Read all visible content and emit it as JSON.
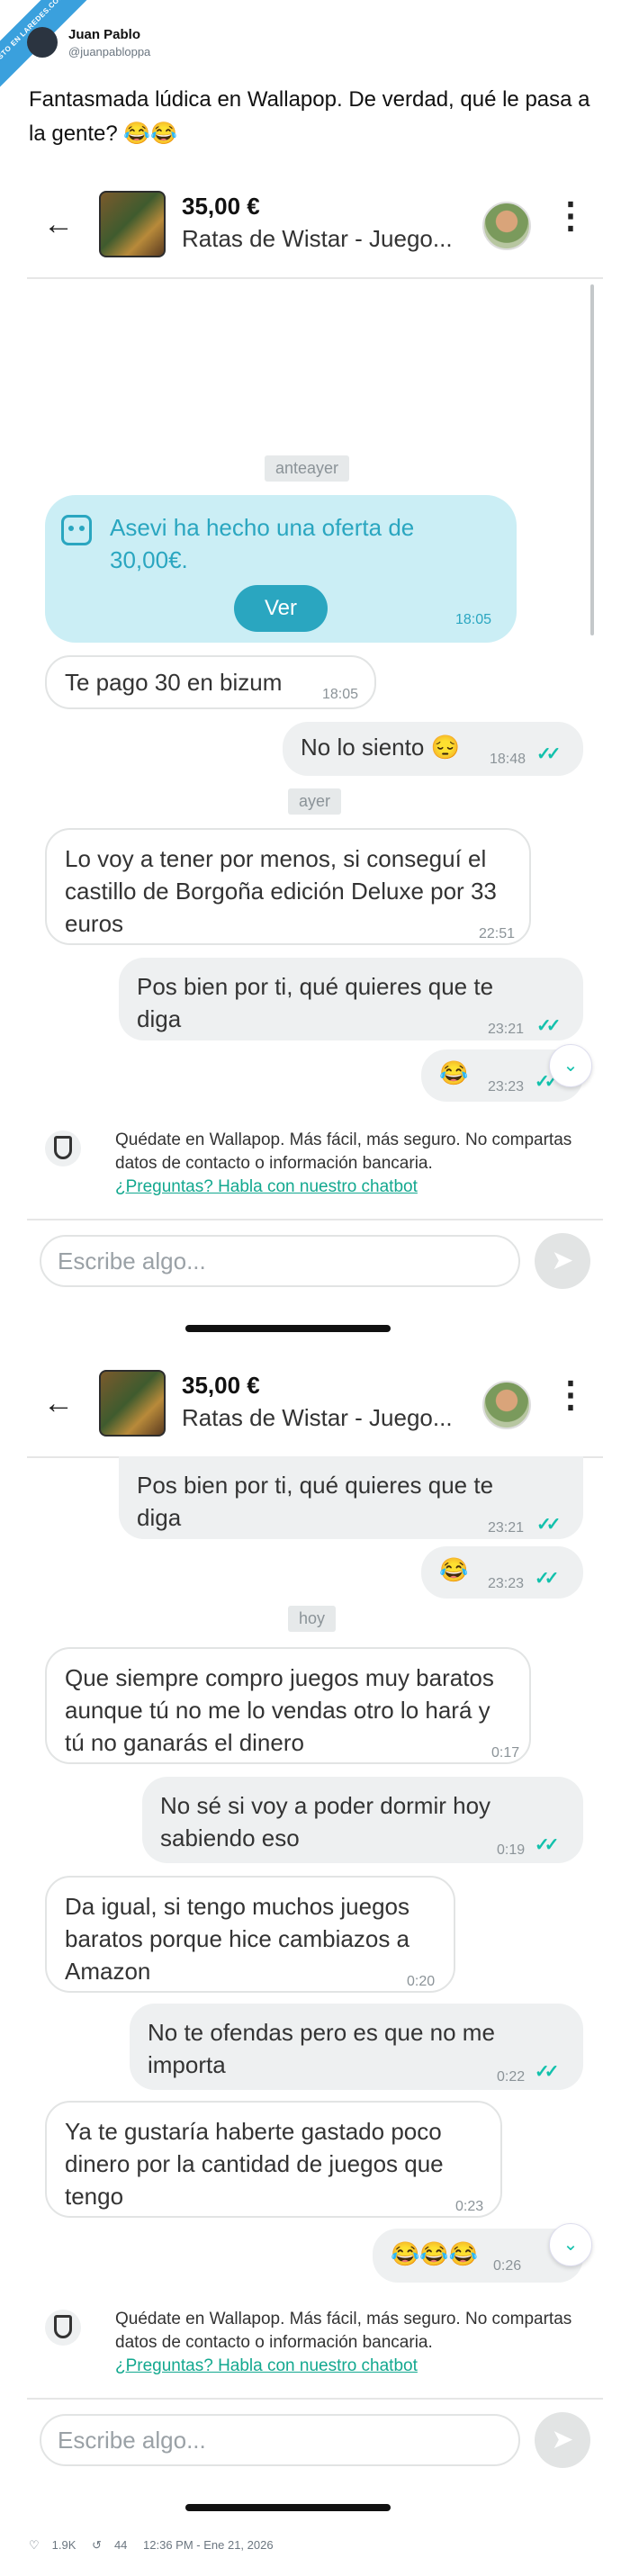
{
  "tweet": {
    "ribbon_text": "VISTO EN LAREDES.COM",
    "author_name": "Juan Pablo",
    "author_handle": "@juanpabloppa",
    "text": "Fantasmada lúdica en Wallapop. De verdad, qué le pasa a la gente? 😂😂"
  },
  "listing": {
    "price": "35,00 €",
    "title": "Ratas de Wistar - Juego..."
  },
  "screen1": {
    "day1": "anteayer",
    "offer_text": "Asevi ha hecho una oferta de 30,00€.",
    "offer_button": "Ver",
    "offer_time": "18:05",
    "m1": {
      "text": "Te pago 30 en bizum",
      "time": "18:05"
    },
    "m2": {
      "text": "No lo siento 😔",
      "time": "18:48"
    },
    "day2": "ayer",
    "m3": {
      "text": "Lo voy a tener por menos, si conseguí el castillo de Borgoña edición Deluxe por 33 euros",
      "time": "22:51"
    },
    "m4": {
      "text": "Pos bien por ti, qué quieres que te diga",
      "time": "23:21"
    },
    "m5": {
      "text": "😂",
      "time": "23:23"
    }
  },
  "screen2": {
    "m4": {
      "text": "Pos bien por ti, qué quieres que te diga",
      "time": "23:21"
    },
    "m5": {
      "text": "😂",
      "time": "23:23"
    },
    "day3": "hoy",
    "m6": {
      "text": "Que siempre compro juegos muy baratos aunque tú no me lo vendas otro lo hará y tú no ganarás el dinero",
      "time": "0:17"
    },
    "m7": {
      "text": "No sé si voy a poder dormir hoy sabiendo eso",
      "time": "0:19"
    },
    "m8": {
      "text": "Da igual, si tengo muchos juegos baratos porque hice cambiazos a Amazon",
      "time": "0:20"
    },
    "m9": {
      "text": "No te ofendas pero es que no me importa",
      "time": "0:22"
    },
    "m10": {
      "text": "Ya te gustaría haberte gastado poco dinero por la cantidad de juegos que tengo",
      "time": "0:23"
    },
    "m11": {
      "text": "😂😂😂",
      "time": "0:26"
    }
  },
  "safety": {
    "text": "Quédate en Wallapop. Más fácil, más seguro. No compartas datos de contacto o información bancaria.",
    "link": "¿Preguntas? Habla con nuestro chatbot"
  },
  "composer": {
    "placeholder": "Escribe algo..."
  },
  "footer": {
    "likes": "1.9K",
    "retweets": "44",
    "date": "12:36 PM - Ene 21, 2026"
  },
  "colors": {
    "accent": "#13c1ac",
    "offer_bg": "#cbeef5",
    "offer_text": "#2aa6c0"
  }
}
